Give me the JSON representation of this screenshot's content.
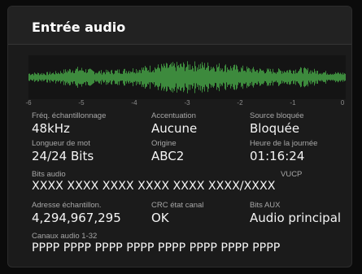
{
  "panel": {
    "title": "Entrée audio"
  },
  "waveform": {
    "color": "#3d8a3d",
    "scale_ticks": [
      "-6",
      "-5",
      "-4",
      "-3",
      "-2",
      "-1",
      "0"
    ]
  },
  "fields": {
    "sample_rate": {
      "label": "Fréq. échantillonnage",
      "value": "48kHz"
    },
    "emphasis": {
      "label": "Accentuation",
      "value": "Aucune"
    },
    "locked_source": {
      "label": "Source bloquée",
      "value": "Bloquée"
    },
    "word_length": {
      "label": "Longueur de mot",
      "value": "24/24 Bits"
    },
    "origin": {
      "label": "Origine",
      "value": "ABC2"
    },
    "time_of_day": {
      "label": "Heure de la journée",
      "value": "01:16:24"
    },
    "audio_bits": {
      "label": "Bits audio",
      "vucp_label": "VUCP",
      "value": "XXXX XXXX XXXX XXXX XXXX XXXX/XXXX"
    },
    "sample_address": {
      "label": "Adresse échantillon.",
      "value": "4,294,967,295"
    },
    "crc": {
      "label": "CRC état canal",
      "value": "OK"
    },
    "aux_bits": {
      "label": "Bits AUX",
      "value": "Audio principal"
    },
    "channels": {
      "label": "Canaux audio 1-32",
      "value": "PPPP PPPP PPPP PPPP PPPP PPPP PPPP PPPP"
    }
  }
}
